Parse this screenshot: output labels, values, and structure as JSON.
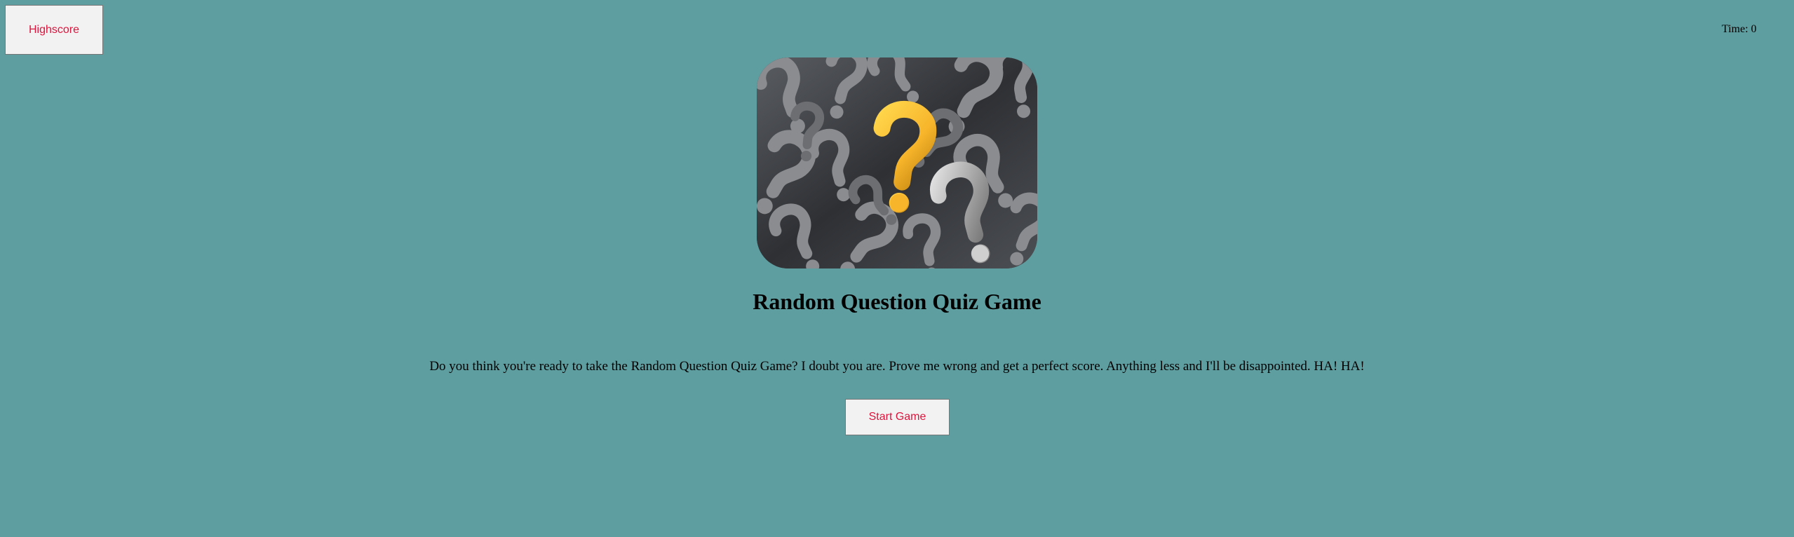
{
  "header": {
    "highscore_label": "Highscore",
    "time_label": "Time: 0"
  },
  "hero": {
    "image_icon": "question-marks-image",
    "accent_color": "#f7b52b"
  },
  "main": {
    "title": "Random Question Quiz Game",
    "description": "Do you think you're ready to take the Random Question Quiz Game? I doubt you are. Prove me wrong and get a perfect score. Anything less and I'll be disappointed. HA! HA!",
    "start_label": "Start Game"
  },
  "colors": {
    "background": "#5f9ea0",
    "button_text": "#dc143c",
    "button_bg": "#f2f2f2"
  }
}
